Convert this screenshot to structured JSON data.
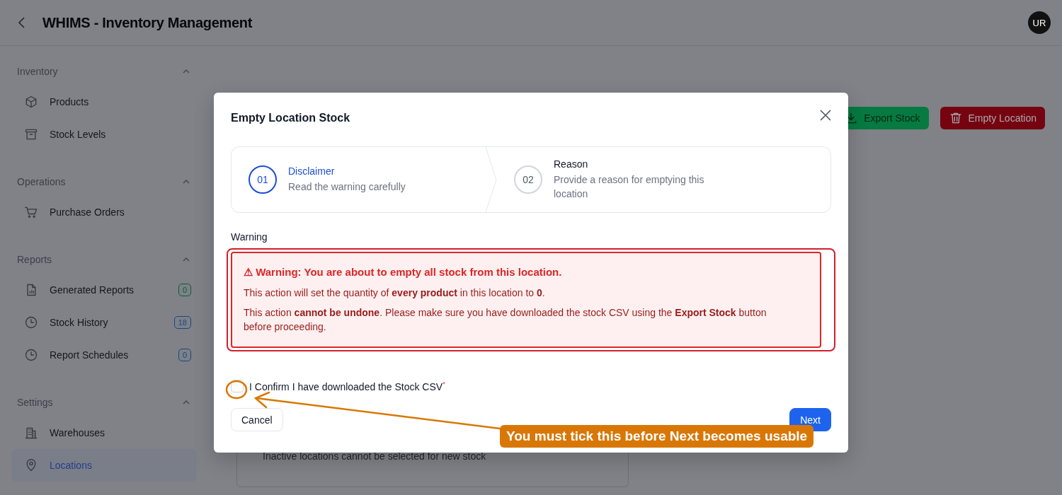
{
  "header": {
    "title": "WHIMS - Inventory Management",
    "avatar": "UR"
  },
  "sidebar": {
    "sections": [
      {
        "title": "Inventory",
        "expanded": true,
        "items": [
          {
            "label": "Products",
            "selected": false
          },
          {
            "label": "Stock Levels",
            "selected": false
          }
        ]
      },
      {
        "title": "Operations",
        "expanded": true,
        "items": [
          {
            "label": "Purchase Orders",
            "selected": false
          }
        ]
      },
      {
        "title": "Reports",
        "expanded": true,
        "items": [
          {
            "label": "Generated Reports",
            "selected": false,
            "badge": "0",
            "color": "#0e5c2c"
          },
          {
            "label": "Stock History",
            "selected": false,
            "badge": "18",
            "color": "#1d4485"
          },
          {
            "label": "Report Schedules",
            "selected": false,
            "badge": "0",
            "color": "#1d4485"
          }
        ]
      },
      {
        "title": "Settings",
        "expanded": true,
        "items": [
          {
            "label": "Warehouses",
            "selected": false
          },
          {
            "label": "Locations",
            "selected": true
          }
        ]
      }
    ]
  },
  "page": {
    "actions": [
      {
        "label": "Export Stock",
        "kind": "success"
      },
      {
        "label": "Empty Location",
        "kind": "danger"
      }
    ],
    "note": "Inactive locations cannot be selected for new stock"
  },
  "dialog": {
    "title": "Empty Location Stock",
    "steps": [
      {
        "number": "01",
        "title": "Disclaimer",
        "description": "Read the warning carefully",
        "selected": true
      },
      {
        "number": "02",
        "title": "Reason",
        "description": "Provide a reason for emptying this location",
        "selected": false
      }
    ],
    "section_label": "Warning",
    "alert": {
      "heading": "⚠ Warning: You are about to empty all stock from this location.",
      "lines": [
        "This action will set the quantity of **every product** in this location to **0**.",
        "This action **cannot be undone**. Please make sure you have downloaded the stock CSV using the **Export Stock** button before proceeding."
      ]
    },
    "confirm": {
      "label": "I Confirm I have downloaded the Stock CSV$^{*}$",
      "checked": false
    },
    "buttons": [
      {
        "label": "Cancel",
        "kind": "secondary"
      },
      {
        "label": "Next",
        "kind": "primary"
      }
    ]
  },
  "annotation": {
    "text": "You must tick this before Next becomes usable"
  }
}
